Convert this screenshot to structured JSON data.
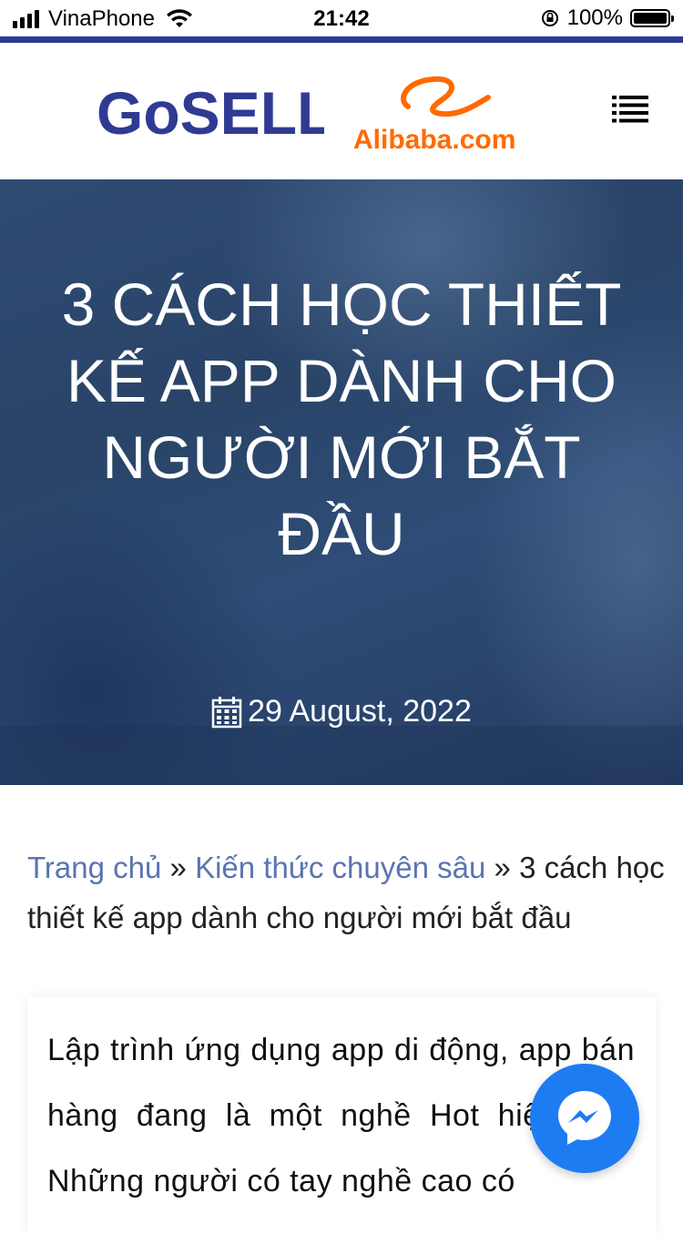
{
  "status_bar": {
    "carrier": "VinaPhone",
    "time": "21:42",
    "battery": "100%"
  },
  "header": {
    "logo_gosell": "GoSELL",
    "logo_alibaba": "Alibaba.com",
    "menu_icon": "list-menu-icon"
  },
  "hero": {
    "title": "3 CÁCH HỌC THIẾT KẾ APP DÀNH CHO NGƯỜI MỚI BẮT ĐẦU",
    "date": "29 August, 2022",
    "date_icon": "calendar-icon"
  },
  "breadcrumb": {
    "home": "Trang chủ",
    "separator": "»",
    "category": "Kiến thức chuyên sâu",
    "current": "3 cách học thiết kế app dành cho người mới bắt đầu"
  },
  "article": {
    "intro": "Lập trình ứng dụng app di động, app bán hàng đang là một nghề Hot hiện nay. Những người có tay nghề cao có"
  },
  "messenger": {
    "icon": "messenger-icon"
  },
  "colors": {
    "brand_bar": "#2f3b93",
    "link": "#5a74b2",
    "messenger": "#1e7cf2",
    "alibaba_orange": "#ff6a00"
  }
}
